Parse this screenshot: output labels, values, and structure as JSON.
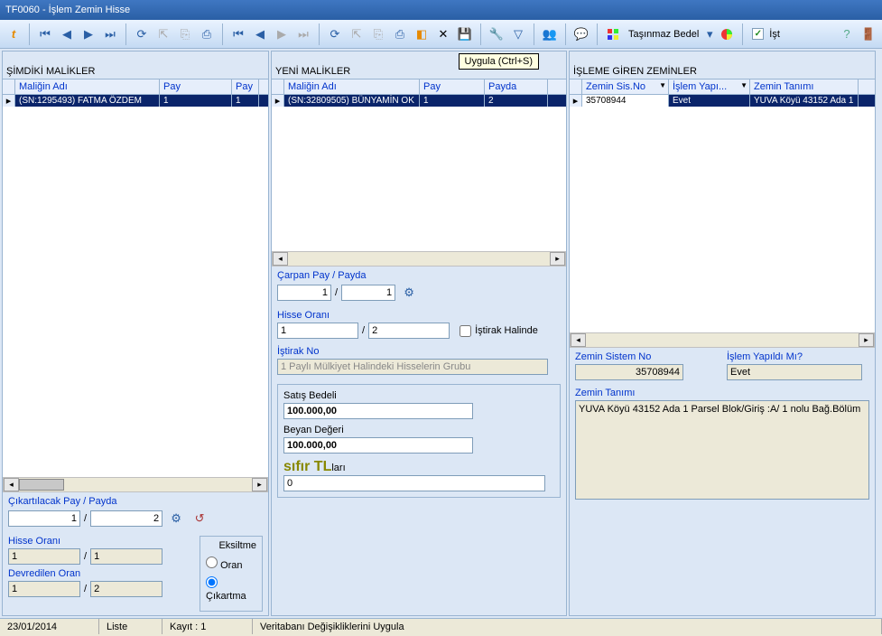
{
  "window": {
    "title": "TF0060 - İşlem Zemin Hisse"
  },
  "toolbar": {
    "tasinmaz_label": "Taşınmaz Bedel",
    "ist_label": "İşt"
  },
  "tooltip": {
    "uygula": "Uygula (Ctrl+S)"
  },
  "left": {
    "title": "ŞİMDİKİ MALİKLER",
    "cols": {
      "ad": "Maliğin Adı",
      "pay": "Pay",
      "payda": "Pay"
    },
    "row": {
      "ad": "(SN:1295493) FATMA ÖZDEM",
      "pay": "1",
      "payda": "1"
    },
    "cikartilacak_label": "Çıkartılacak Pay / Payda",
    "cikart_pay": "1",
    "cikart_payda": "2",
    "hisse_label": "Hisse Oranı",
    "hisse_pay": "1",
    "hisse_payda": "1",
    "devredilen_label": "Devredilen Oran",
    "devr_pay": "1",
    "devr_payda": "2",
    "eksiltme": {
      "title": "Eksiltme",
      "oran": "Oran",
      "cikartma": "Çıkartma"
    }
  },
  "mid": {
    "title": "YENİ MALİKLER",
    "cols": {
      "ad": "Maliğin Adı",
      "pay": "Pay",
      "payda": "Payda"
    },
    "row": {
      "ad": "(SN:32809505) BÜNYAMİN OK",
      "pay": "1",
      "payda": "2"
    },
    "carpan_label": "Çarpan Pay / Payda",
    "carpan_pay": "1",
    "carpan_payda": "1",
    "hisse_label": "Hisse Oranı",
    "hisse_pay": "1",
    "hisse_payda": "2",
    "istirak_chk": "İştirak Halinde",
    "istirak_no_label": "İştirak No",
    "istirak_no_ph": "1 Paylı Mülkiyet Halindeki Hisselerin Grubu",
    "satis_label": "Satış Bedeli",
    "satis_val": "100.000,00",
    "beyan_label": "Beyan Değeri",
    "beyan_val": "100.000,00",
    "tl_sifir": "sıfır TL",
    "tl_suffix": "ları",
    "tl_input": "0"
  },
  "right": {
    "title": "İŞLEME GİREN ZEMİNLER",
    "cols": {
      "sis": "Zemin Sis.No",
      "yapildi": "İşlem Yapı...",
      "tanim": "Zemin Tanımı"
    },
    "row": {
      "sis": "35708944",
      "yapildi": "Evet",
      "tanim": "YUVA Köyü 43152 Ada 1"
    },
    "zsn_label": "Zemin Sistem No",
    "zsn_val": "35708944",
    "iy_label": "İşlem Yapıldı Mı?",
    "iy_val": "Evet",
    "zt_label": "Zemin Tanımı",
    "zt_val": "YUVA Köyü 43152 Ada 1 Parsel Blok/Giriş :A/ 1 nolu Bağ.Bölüm"
  },
  "status": {
    "date": "23/01/2014",
    "liste": "Liste",
    "kayit": "Kayıt : 1",
    "msg": "Veritabanı Değişikliklerini Uygula"
  }
}
